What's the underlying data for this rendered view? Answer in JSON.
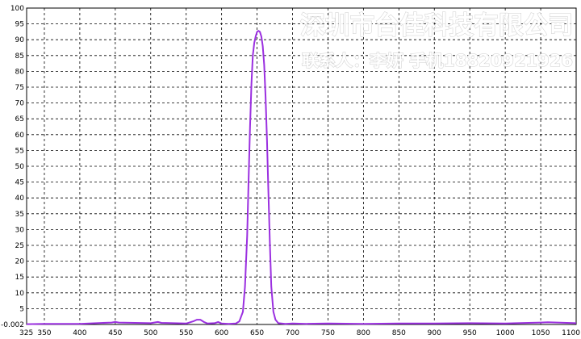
{
  "chart_data": {
    "type": "line",
    "title": "",
    "xlabel": "",
    "ylabel": "",
    "xlim": [
      325,
      1100
    ],
    "ylim": [
      -0.002,
      100
    ],
    "x_ticks": [
      325,
      350,
      400,
      450,
      500,
      550,
      600,
      650,
      700,
      750,
      800,
      850,
      900,
      950,
      1000,
      1050,
      1100
    ],
    "y_ticks": [
      100,
      95,
      90,
      85,
      80,
      75,
      70,
      65,
      60,
      55,
      50,
      45,
      40,
      35,
      30,
      25,
      20,
      15,
      10,
      5,
      -0.002
    ],
    "grid": true,
    "series": [
      {
        "color": "#9b30e0",
        "x": [
          325,
          350,
          400,
          445,
          450,
          455,
          500,
          510,
          515,
          550,
          560,
          565,
          570,
          575,
          580,
          590,
          595,
          600,
          610,
          620,
          625,
          630,
          633,
          636,
          638,
          640,
          642,
          644,
          646,
          648,
          650,
          652,
          654,
          656,
          658,
          660,
          662,
          664,
          666,
          668,
          670,
          673,
          676,
          680,
          690,
          700,
          720,
          750,
          800,
          850,
          900,
          950,
          1000,
          1050,
          1060,
          1100
        ],
        "y": [
          0.1,
          0.2,
          0.2,
          0.6,
          0.8,
          0.6,
          0.4,
          0.8,
          0.5,
          0.3,
          1.0,
          1.5,
          1.5,
          0.8,
          0.3,
          0.4,
          0.8,
          0.3,
          0.2,
          0.3,
          1.0,
          4,
          12,
          28,
          45,
          62,
          76,
          85,
          89,
          91,
          92.5,
          92.8,
          92.5,
          91,
          88,
          82,
          72,
          58,
          42,
          26,
          12,
          4,
          1.5,
          0.4,
          0.2,
          0.3,
          0.2,
          0.3,
          0.2,
          0.3,
          0.3,
          0.4,
          0.3,
          0.6,
          0.7,
          0.4
        ]
      }
    ]
  },
  "watermark": {
    "company": "深圳市台佳科技有限公司",
    "contact": "联系人：李妍 手机18820921926"
  }
}
